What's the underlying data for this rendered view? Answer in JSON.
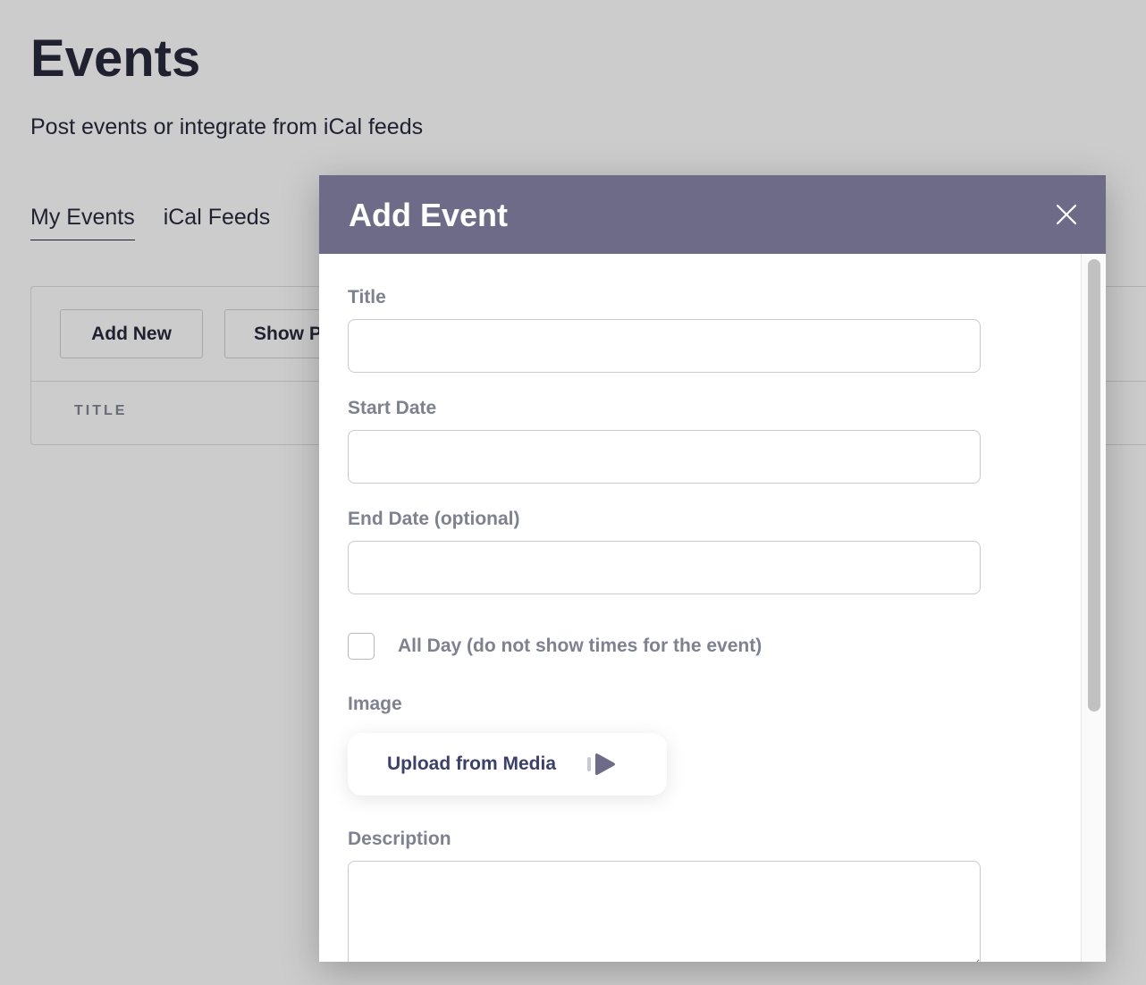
{
  "page": {
    "title": "Events",
    "subtitle": "Post events or integrate from iCal feeds",
    "tabs": [
      {
        "label": "My Events",
        "active": true
      },
      {
        "label": "iCal Feeds",
        "active": false
      }
    ],
    "toolbar": {
      "add_new_label": "Add New",
      "show_label": "Show P"
    },
    "table": {
      "columns": [
        "TITLE"
      ]
    }
  },
  "modal": {
    "title": "Add Event",
    "close_icon": "close-icon",
    "header_color": "#6e6b88",
    "fields": {
      "title_label": "Title",
      "title_value": "",
      "start_date_label": "Start Date",
      "start_date_value": "",
      "end_date_label": "End Date (optional)",
      "end_date_value": "",
      "all_day_label": "All Day (do not show times for the event)",
      "all_day_checked": false,
      "image_label": "Image",
      "upload_label": "Upload from Media",
      "upload_icon": "play-arrow-icon",
      "description_label": "Description",
      "description_value": ""
    }
  }
}
